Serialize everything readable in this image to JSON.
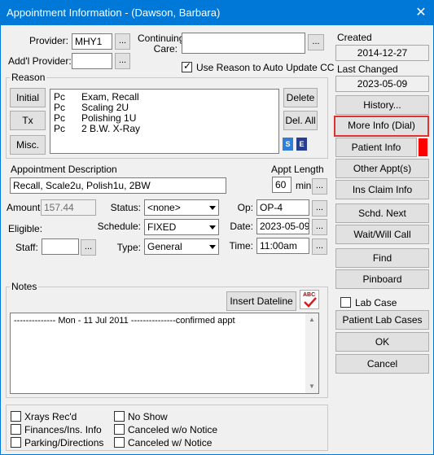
{
  "window": {
    "title": "Appointment Information - (Dawson, Barbara)",
    "close_glyph": "✕"
  },
  "provider": {
    "label": "Provider:",
    "value": "MHY1",
    "lookup": "..."
  },
  "addl_provider": {
    "label": "Add'l Provider:",
    "value": "",
    "lookup": "..."
  },
  "continuing_care": {
    "label_line1": "Continuing",
    "label_line2": "Care:",
    "value": "",
    "lookup": "..."
  },
  "use_reason": {
    "label": "Use Reason to Auto Update CC",
    "checked": true
  },
  "reason": {
    "legend": "Reason",
    "buttons": {
      "initial": "Initial",
      "tx": "Tx",
      "misc": "Misc.",
      "delete": "Delete",
      "del_all": "Del. All"
    },
    "items": [
      {
        "code": "Pc",
        "desc": "Exam, Recall"
      },
      {
        "code": "Pc",
        "desc": "Scaling 2U"
      },
      {
        "code": "Pc",
        "desc": "Polishing 1U"
      },
      {
        "code": "Pc",
        "desc": "2 B.W. X-Ray"
      }
    ],
    "icon_s": "S",
    "icon_e": "E"
  },
  "appt_desc": {
    "label": "Appointment Description",
    "value": "Recall, Scale2u, Polish1u, 2BW"
  },
  "appt_length": {
    "label": "Appt Length",
    "value": "60",
    "unit": "min",
    "lookup": "..."
  },
  "amount": {
    "label": "Amount:",
    "value": "157.44"
  },
  "eligible": {
    "label": "Eligible:"
  },
  "staff": {
    "label": "Staff:",
    "value": "",
    "lookup": "..."
  },
  "status": {
    "label": "Status:",
    "value": "<none>"
  },
  "schedule": {
    "label": "Schedule:",
    "value": "FIXED"
  },
  "type": {
    "label": "Type:",
    "value": "General"
  },
  "op": {
    "label": "Op:",
    "value": "OP-4",
    "lookup": "..."
  },
  "date": {
    "label": "Date:",
    "value": "2023-05-09",
    "lookup": "..."
  },
  "time": {
    "label": "Time:",
    "value": "11:00am",
    "lookup": "..."
  },
  "notes": {
    "legend": "Notes",
    "insert_dateline": "Insert Dateline",
    "spell_icon": "ABC",
    "text": "-------------- Mon - 11 Jul 2011 ---------------confirmed appt"
  },
  "checkboxes": {
    "xrays": "Xrays Rec'd",
    "finances": "Finances/Ins. Info",
    "parking": "Parking/Directions",
    "no_show": "No Show",
    "canceled_wo": "Canceled w/o Notice",
    "canceled_w": "Canceled w/ Notice"
  },
  "sidebar": {
    "created_label": "Created",
    "created_value": "2014-12-27",
    "last_changed_label": "Last Changed",
    "last_changed_value": "2023-05-09",
    "history": "History...",
    "more_info": "More Info (Dial)",
    "patient_info": "Patient Info",
    "other_appts": "Other Appt(s)",
    "ins_claim": "Ins Claim Info",
    "schd_next": "Schd. Next",
    "wait_will_call": "Wait/Will Call",
    "find": "Find",
    "pinboard": "Pinboard",
    "lab_case": "Lab Case",
    "patient_lab_cases": "Patient Lab Cases",
    "ok": "OK",
    "cancel": "Cancel"
  },
  "colors": {
    "titlebar": "#0078d7",
    "alert": "#ff0000",
    "focus_border": "#e03030"
  }
}
